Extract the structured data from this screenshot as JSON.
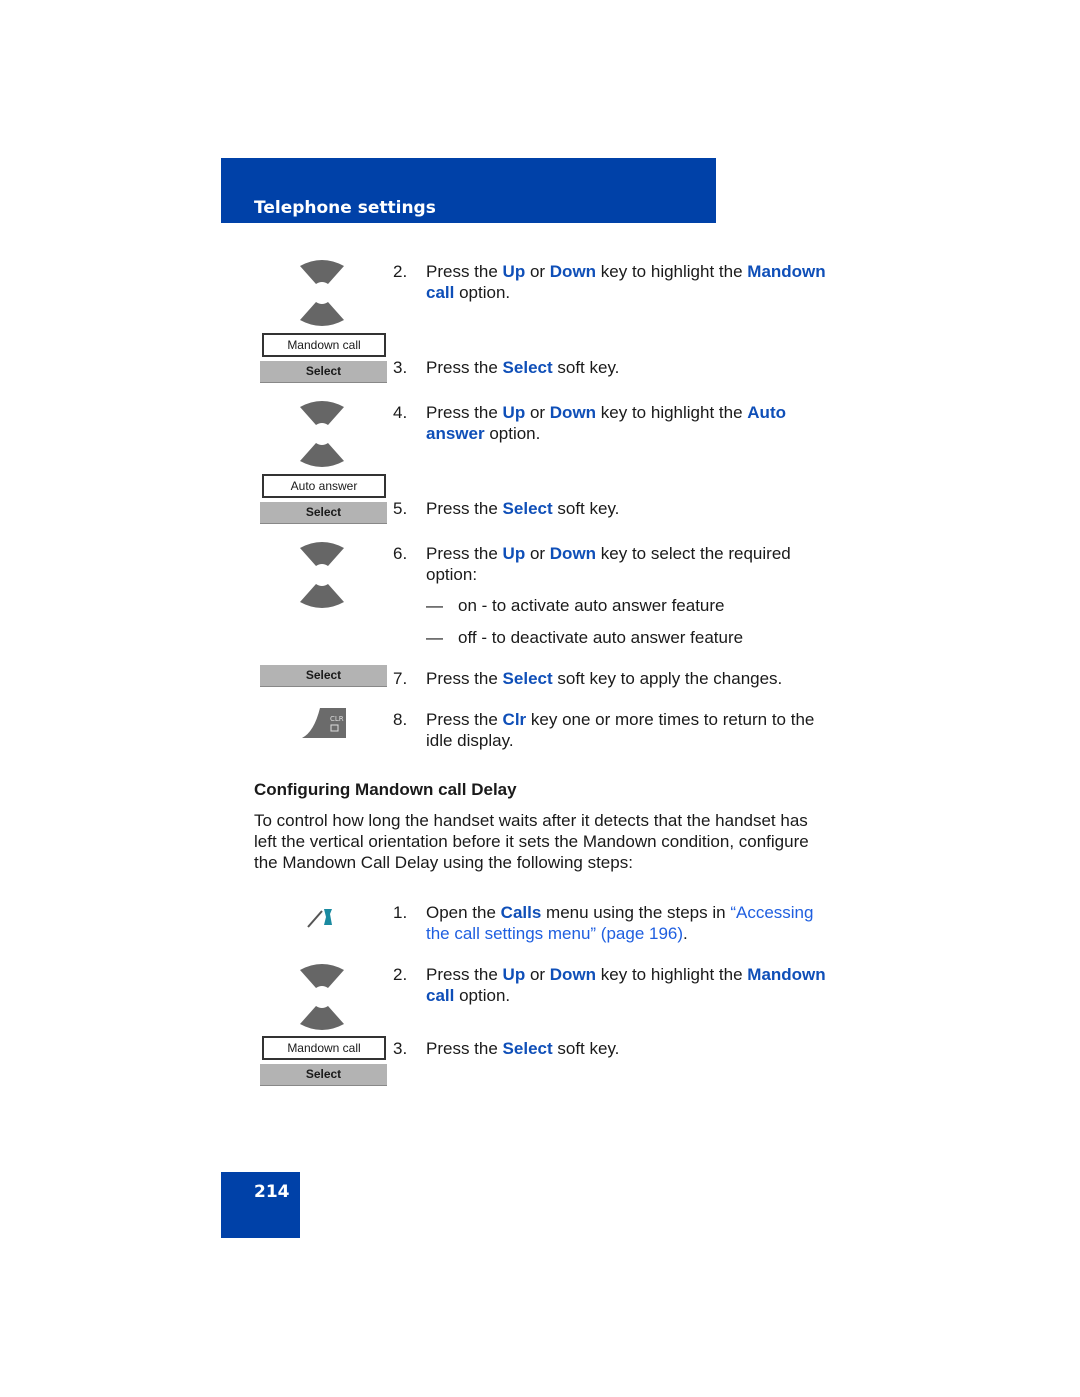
{
  "header": {
    "title": "Telephone settings"
  },
  "page_number": "214",
  "icons": {
    "display1": "Mandown call",
    "select1": "Select",
    "display2": "Auto answer",
    "select2": "Select",
    "select3": "Select",
    "select4": "Select",
    "display3": "Mandown call",
    "select5": "Select"
  },
  "steps": [
    {
      "num": "2.",
      "segs": [
        {
          "t": "Press the "
        },
        {
          "t": "Up",
          "c": "hl"
        },
        {
          "t": " or "
        },
        {
          "t": "Down",
          "c": "hl"
        },
        {
          "t": " key to highlight the "
        },
        {
          "t": "Mandown call",
          "c": "hl"
        },
        {
          "t": " option."
        }
      ]
    },
    {
      "num": "3.",
      "segs": [
        {
          "t": "Press the "
        },
        {
          "t": "Select",
          "c": "hl"
        },
        {
          "t": " soft key."
        }
      ]
    },
    {
      "num": "4.",
      "segs": [
        {
          "t": "Press the "
        },
        {
          "t": "Up",
          "c": "hl"
        },
        {
          "t": " or "
        },
        {
          "t": "Down",
          "c": "hl"
        },
        {
          "t": " key to highlight the "
        },
        {
          "t": "Auto answer",
          "c": "hl"
        },
        {
          "t": " option."
        }
      ]
    },
    {
      "num": "5.",
      "segs": [
        {
          "t": "Press the "
        },
        {
          "t": "Select",
          "c": "hl"
        },
        {
          "t": " soft key."
        }
      ]
    },
    {
      "num": "6.",
      "segs": [
        {
          "t": "Press the "
        },
        {
          "t": "Up",
          "c": "hl"
        },
        {
          "t": " or "
        },
        {
          "t": "Down",
          "c": "hl"
        },
        {
          "t": " key to select the required option:"
        }
      ]
    },
    {
      "num": "7.",
      "segs": [
        {
          "t": "Press the "
        },
        {
          "t": "Select",
          "c": "hl"
        },
        {
          "t": " soft key to apply the changes."
        }
      ]
    },
    {
      "num": "8.",
      "segs": [
        {
          "t": "Press the "
        },
        {
          "t": "Clr",
          "c": "hl"
        },
        {
          "t": " key one or more times to return to the idle display."
        }
      ]
    },
    {
      "num": "1.",
      "segs": [
        {
          "t": "Open the "
        },
        {
          "t": "Calls",
          "c": "hl"
        },
        {
          "t": " menu using the steps in "
        },
        {
          "t": "“Accessing the call settings menu” (page 196)",
          "c": "lk"
        },
        {
          "t": "."
        }
      ]
    },
    {
      "num": "2.",
      "segs": [
        {
          "t": "Press the "
        },
        {
          "t": "Up",
          "c": "hl"
        },
        {
          "t": " or "
        },
        {
          "t": "Down",
          "c": "hl"
        },
        {
          "t": " key to highlight the "
        },
        {
          "t": "Mandown call",
          "c": "hl"
        },
        {
          "t": " option."
        }
      ]
    },
    {
      "num": "3.",
      "segs": [
        {
          "t": "Press the "
        },
        {
          "t": "Select",
          "c": "hl"
        },
        {
          "t": " soft key."
        }
      ]
    }
  ],
  "bullets": [
    {
      "dash": "—",
      "text": "on - to activate auto answer feature"
    },
    {
      "dash": "—",
      "text": "off - to deactivate auto answer feature"
    }
  ],
  "section": {
    "title": "Configuring Mandown call Delay",
    "intro": "To control how long the handset waits after it detects that the handset has left the vertical orientation before it sets the Mandown condition, configure the Mandown Call Delay using the following steps:"
  },
  "colors": {
    "header": "#0041a8",
    "highlight": "#0f4fb8",
    "link": "#1f5fe0"
  }
}
